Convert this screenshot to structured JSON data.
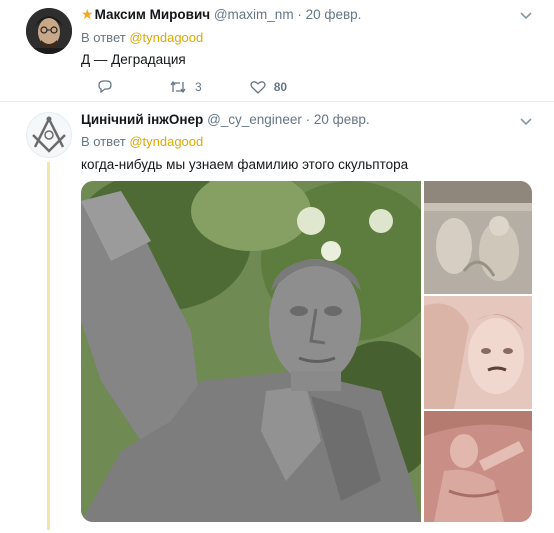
{
  "tweets": [
    {
      "name": "Максим Мирович",
      "handle": "@maxim_nm",
      "date": "20 февр.",
      "reply_prefix": "В ответ",
      "reply_to": "@tyndagood",
      "text": "Д — Деградация",
      "retweets": "3",
      "likes": "80"
    },
    {
      "name": "Цинічний інжОнер",
      "handle": "@_cy_engineer",
      "date": "20 февр.",
      "reply_prefix": "В ответ",
      "reply_to": "@tyndagood",
      "text": "когда-нибудь мы узнаем фамилию этого скульптора"
    }
  ],
  "icons": {
    "star": "star-icon",
    "more": "chevron-down-icon",
    "reply": "reply-icon",
    "retweet": "retweet-icon",
    "like": "heart-icon",
    "masonic": "square-and-compass-icon"
  },
  "colors": {
    "link": "#e0a800",
    "muted": "#657786",
    "thread": "#f5e6a8",
    "star": "#f5a623"
  }
}
